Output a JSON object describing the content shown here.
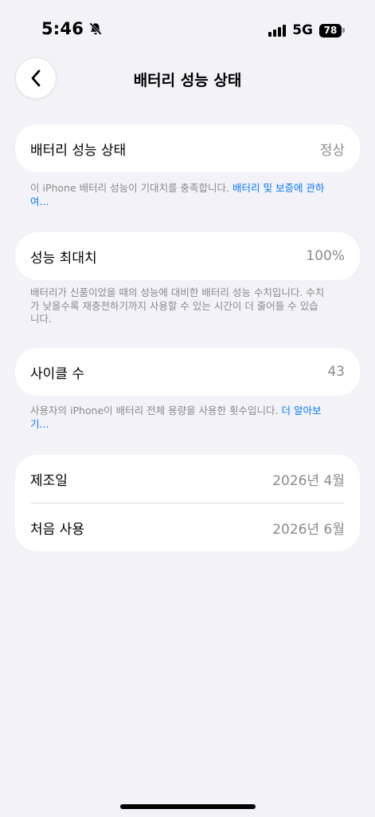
{
  "status_bar": {
    "time": "5:46",
    "network": "5G",
    "battery_level": "78"
  },
  "nav": {
    "title": "배터리 성능 상태"
  },
  "sections": {
    "health": {
      "label": "배터리 성능 상태",
      "value": "정상",
      "footnote_text": "이 iPhone 배터리 성능이 기대치를 충족합니다. ",
      "footnote_link": "배터리 및 보증에 관하여..."
    },
    "capacity": {
      "label": "성능 최대치",
      "value": "100%",
      "footnote_text": "배터리가 신품이었을 때의 성능에 대비한 배터리 성능 수치입니다. 수치가 낮을수록 재충전하기까지 사용할 수 있는 시간이 더 줄어들 수 있습니다."
    },
    "cycles": {
      "label": "사이클 수",
      "value": "43",
      "footnote_text": "사용자의 iPhone이 배터리 전체 용량을 사용한 횟수입니다. ",
      "footnote_link": "더 알아보기..."
    },
    "dates": {
      "manufactured_label": "제조일",
      "manufactured_value": "2026년 4월",
      "first_use_label": "처음 사용",
      "first_use_value": "2026년 6월"
    }
  },
  "colors": {
    "background": "#f2f2f7",
    "link": "#0a7aff",
    "secondary_text": "#8a8a8e"
  }
}
